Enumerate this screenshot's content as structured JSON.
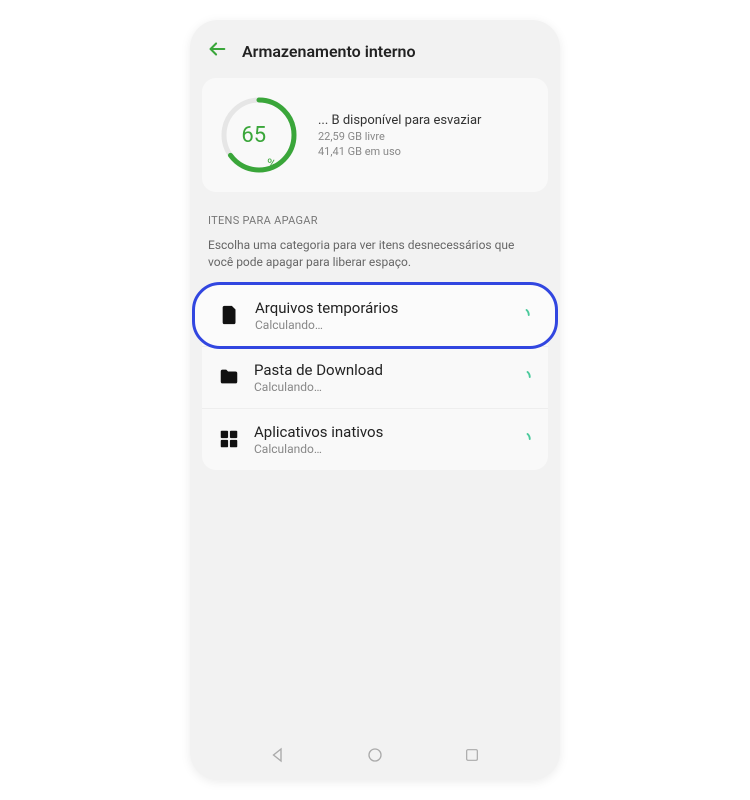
{
  "header": {
    "title": "Armazenamento interno"
  },
  "storage": {
    "percent": "65",
    "percentSymbol": "%",
    "available": "... B disponível para esvaziar",
    "free": "22,59 GB livre",
    "used": "41,41 GB em uso"
  },
  "section": {
    "header": "ITENS PARA APAGAR",
    "desc": "Escolha uma categoria para ver itens desnecessários que você pode apagar para liberar espaço."
  },
  "items": [
    {
      "title": "Arquivos temporários",
      "sub": "Calculando…"
    },
    {
      "title": "Pasta de Download",
      "sub": "Calculando…"
    },
    {
      "title": "Aplicativos inativos",
      "sub": "Calculando…"
    }
  ],
  "colors": {
    "accent": "#3aa63a",
    "highlight": "#3146e0"
  }
}
